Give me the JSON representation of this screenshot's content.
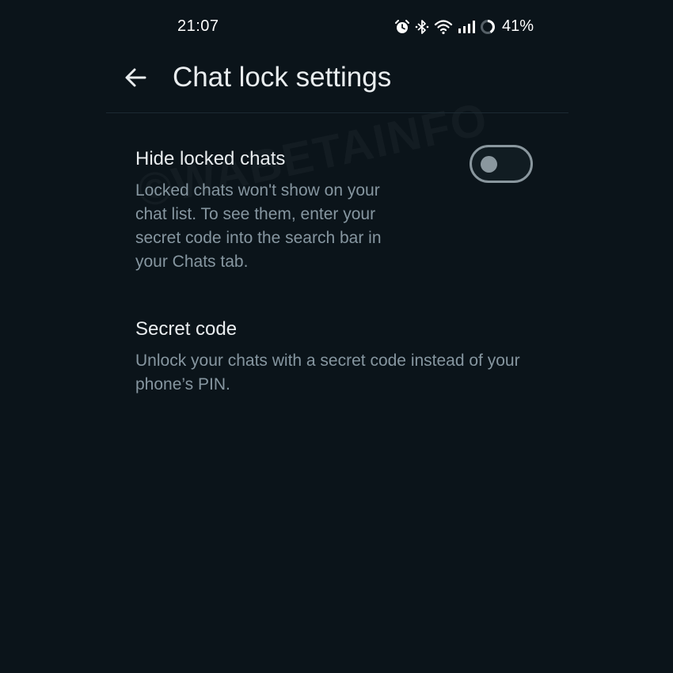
{
  "status_bar": {
    "time": "21:07",
    "battery_percent": "41%",
    "icons": [
      "alarm-icon",
      "bluetooth-icon",
      "wifi-icon",
      "signal-icon",
      "battery-icon"
    ]
  },
  "header": {
    "back_icon": "arrow-left-icon",
    "title": "Chat lock settings"
  },
  "settings": {
    "hide_locked_chats": {
      "title": "Hide locked chats",
      "description": "Locked chats won't show on your chat list. To see them, enter your secret code into the search bar in your Chats tab.",
      "toggle_on": false
    },
    "secret_code": {
      "title": "Secret code",
      "description": "Unlock your chats with a secret code instead of your phone’s PIN."
    }
  },
  "watermark": "©WABETAINFO",
  "colors": {
    "background": "#0b141a",
    "primary_text": "#e9edef",
    "secondary_text": "#8696a0",
    "toggle_off": "#8a979e"
  }
}
